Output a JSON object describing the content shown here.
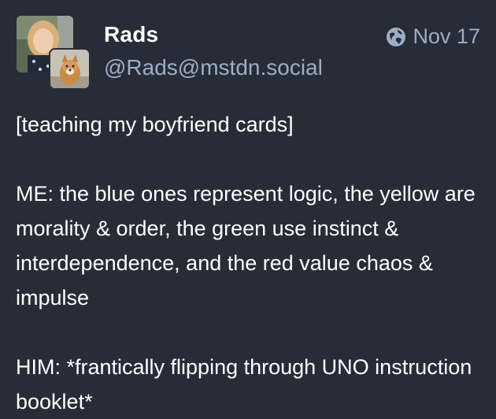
{
  "post": {
    "display_name": "Rads",
    "handle": "@Rads@mstdn.social",
    "visibility_icon": "globe-icon",
    "date": "Nov 17",
    "paragraphs": [
      "[teaching my boyfriend cards]",
      "ME: the blue ones represent logic, the yellow are morality & order, the green use instinct & interdependence, and the red value chaos & impulse",
      "HIM: *frantically flipping through UNO instruction booklet*"
    ]
  },
  "colors": {
    "background": "#282c37",
    "text": "#ffffff",
    "secondary_text": "#9baec8"
  }
}
